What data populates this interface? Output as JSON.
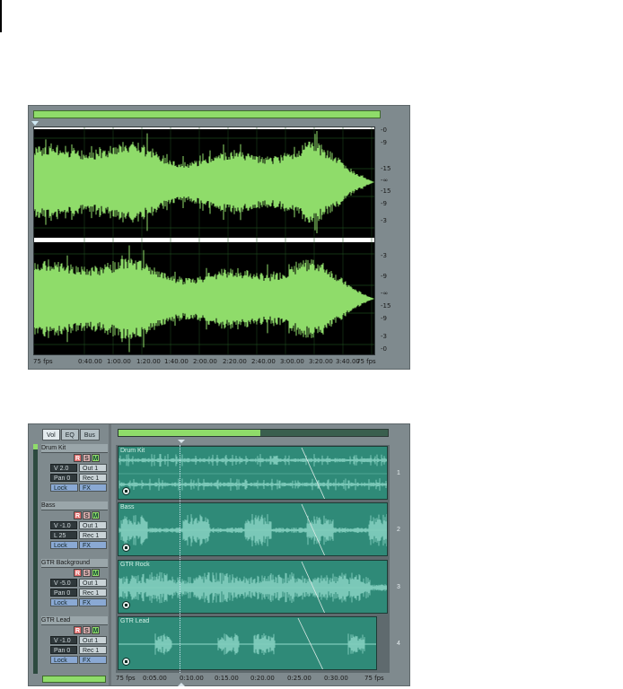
{
  "waveform_editor": {
    "db_scale": [
      "-0",
      "-9",
      "-15",
      "-∞",
      "-15",
      "-9",
      "-3",
      "-3",
      "-9",
      "-∞",
      "-15",
      "-9",
      "-3",
      "-0"
    ],
    "time_ruler": [
      "75 fps",
      "0:40.00",
      "1:00.00",
      "1:20.00",
      "1:40.00",
      "2:00.00",
      "2:20.00",
      "2:40.00",
      "3:00.00",
      "3:20.00",
      "3:40.00",
      "75 fps"
    ]
  },
  "multitrack": {
    "tabs": [
      "Vol",
      "EQ",
      "Bus"
    ],
    "tracks": [
      {
        "name": "Drum Kit",
        "r": "R",
        "s": "S",
        "m": "M",
        "field1": "V 2.0",
        "field2": "Pan 0",
        "btn1": "Out 1",
        "btn2": "Rec 1",
        "lock": "Lock",
        "fx": "FX",
        "clip_title": "Drum Kit",
        "number": "1"
      },
      {
        "name": "Bass",
        "r": "R",
        "s": "S",
        "m": "M",
        "field1": "V -1.0",
        "field2": "L 25",
        "btn1": "Out 1",
        "btn2": "Rec 1",
        "lock": "Lock",
        "fx": "FX",
        "clip_title": "Bass",
        "number": "2"
      },
      {
        "name": "GTR Background",
        "r": "R",
        "s": "S",
        "m": "M",
        "field1": "V -5.0",
        "field2": "Pan 0",
        "btn1": "Out 1",
        "btn2": "Rec 1",
        "lock": "Lock",
        "fx": "FX",
        "clip_title": "GTR Rock",
        "number": "3"
      },
      {
        "name": "GTR Lead",
        "r": "R",
        "s": "S",
        "m": "M",
        "field1": "V -1.0",
        "field2": "Pan 0",
        "btn1": "Out 1",
        "btn2": "Rec 1",
        "lock": "Lock",
        "fx": "FX",
        "clip_title": "GTR Lead",
        "number": "4"
      }
    ],
    "ruler": [
      "75 fps",
      "0:05.00",
      "0:10.00",
      "0:15.00",
      "0:20.00",
      "0:25.00",
      "0:30.00",
      "75 fps"
    ]
  },
  "colors": {
    "wave_green": "#8fdc6a",
    "clip_teal": "#2f8a78",
    "panel_gray": "#7f8a8e"
  }
}
